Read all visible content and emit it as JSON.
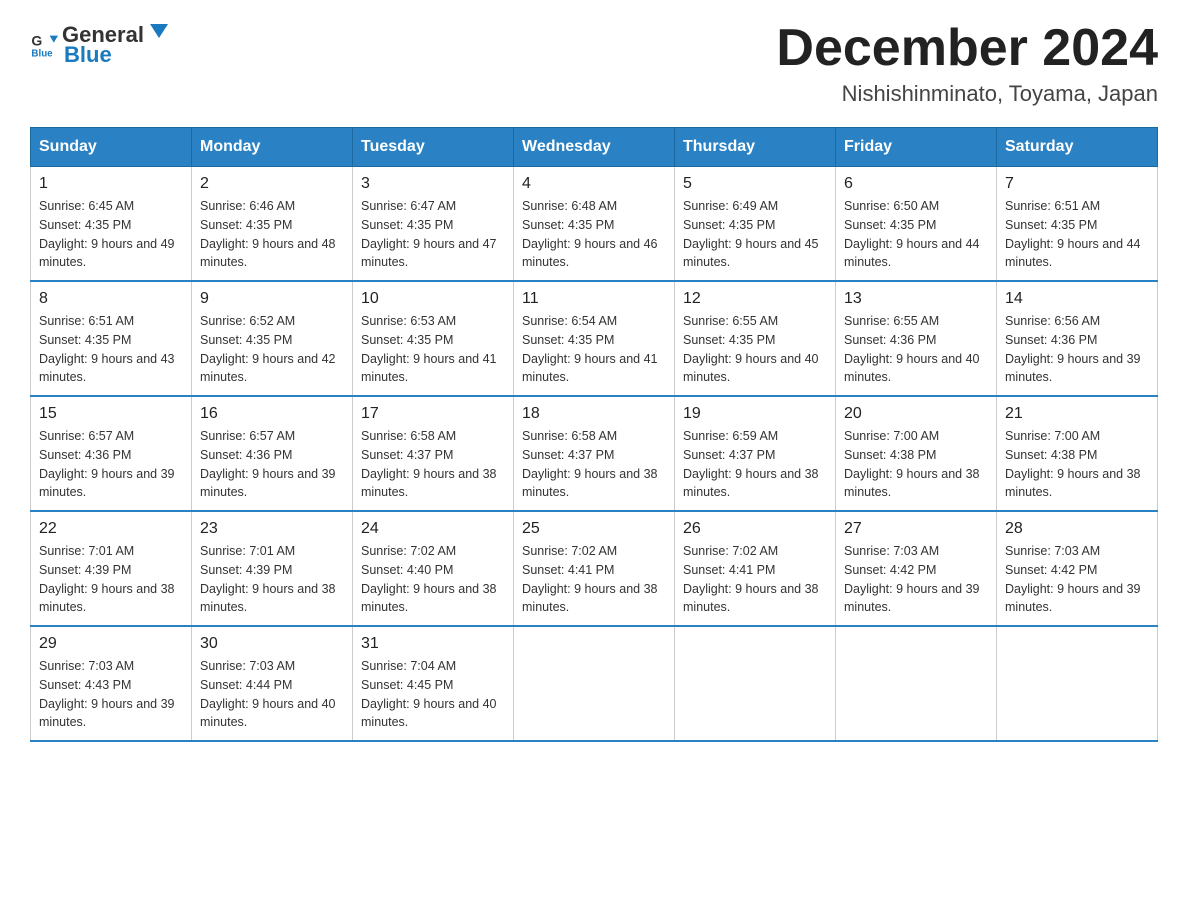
{
  "header": {
    "logo_general": "General",
    "logo_blue": "Blue",
    "month_title": "December 2024",
    "location": "Nishishinminato, Toyama, Japan"
  },
  "weekdays": [
    "Sunday",
    "Monday",
    "Tuesday",
    "Wednesday",
    "Thursday",
    "Friday",
    "Saturday"
  ],
  "weeks": [
    [
      {
        "day": "1",
        "sunrise": "6:45 AM",
        "sunset": "4:35 PM",
        "daylight": "9 hours and 49 minutes."
      },
      {
        "day": "2",
        "sunrise": "6:46 AM",
        "sunset": "4:35 PM",
        "daylight": "9 hours and 48 minutes."
      },
      {
        "day": "3",
        "sunrise": "6:47 AM",
        "sunset": "4:35 PM",
        "daylight": "9 hours and 47 minutes."
      },
      {
        "day": "4",
        "sunrise": "6:48 AM",
        "sunset": "4:35 PM",
        "daylight": "9 hours and 46 minutes."
      },
      {
        "day": "5",
        "sunrise": "6:49 AM",
        "sunset": "4:35 PM",
        "daylight": "9 hours and 45 minutes."
      },
      {
        "day": "6",
        "sunrise": "6:50 AM",
        "sunset": "4:35 PM",
        "daylight": "9 hours and 44 minutes."
      },
      {
        "day": "7",
        "sunrise": "6:51 AM",
        "sunset": "4:35 PM",
        "daylight": "9 hours and 44 minutes."
      }
    ],
    [
      {
        "day": "8",
        "sunrise": "6:51 AM",
        "sunset": "4:35 PM",
        "daylight": "9 hours and 43 minutes."
      },
      {
        "day": "9",
        "sunrise": "6:52 AM",
        "sunset": "4:35 PM",
        "daylight": "9 hours and 42 minutes."
      },
      {
        "day": "10",
        "sunrise": "6:53 AM",
        "sunset": "4:35 PM",
        "daylight": "9 hours and 41 minutes."
      },
      {
        "day": "11",
        "sunrise": "6:54 AM",
        "sunset": "4:35 PM",
        "daylight": "9 hours and 41 minutes."
      },
      {
        "day": "12",
        "sunrise": "6:55 AM",
        "sunset": "4:35 PM",
        "daylight": "9 hours and 40 minutes."
      },
      {
        "day": "13",
        "sunrise": "6:55 AM",
        "sunset": "4:36 PM",
        "daylight": "9 hours and 40 minutes."
      },
      {
        "day": "14",
        "sunrise": "6:56 AM",
        "sunset": "4:36 PM",
        "daylight": "9 hours and 39 minutes."
      }
    ],
    [
      {
        "day": "15",
        "sunrise": "6:57 AM",
        "sunset": "4:36 PM",
        "daylight": "9 hours and 39 minutes."
      },
      {
        "day": "16",
        "sunrise": "6:57 AM",
        "sunset": "4:36 PM",
        "daylight": "9 hours and 39 minutes."
      },
      {
        "day": "17",
        "sunrise": "6:58 AM",
        "sunset": "4:37 PM",
        "daylight": "9 hours and 38 minutes."
      },
      {
        "day": "18",
        "sunrise": "6:58 AM",
        "sunset": "4:37 PM",
        "daylight": "9 hours and 38 minutes."
      },
      {
        "day": "19",
        "sunrise": "6:59 AM",
        "sunset": "4:37 PM",
        "daylight": "9 hours and 38 minutes."
      },
      {
        "day": "20",
        "sunrise": "7:00 AM",
        "sunset": "4:38 PM",
        "daylight": "9 hours and 38 minutes."
      },
      {
        "day": "21",
        "sunrise": "7:00 AM",
        "sunset": "4:38 PM",
        "daylight": "9 hours and 38 minutes."
      }
    ],
    [
      {
        "day": "22",
        "sunrise": "7:01 AM",
        "sunset": "4:39 PM",
        "daylight": "9 hours and 38 minutes."
      },
      {
        "day": "23",
        "sunrise": "7:01 AM",
        "sunset": "4:39 PM",
        "daylight": "9 hours and 38 minutes."
      },
      {
        "day": "24",
        "sunrise": "7:02 AM",
        "sunset": "4:40 PM",
        "daylight": "9 hours and 38 minutes."
      },
      {
        "day": "25",
        "sunrise": "7:02 AM",
        "sunset": "4:41 PM",
        "daylight": "9 hours and 38 minutes."
      },
      {
        "day": "26",
        "sunrise": "7:02 AM",
        "sunset": "4:41 PM",
        "daylight": "9 hours and 38 minutes."
      },
      {
        "day": "27",
        "sunrise": "7:03 AM",
        "sunset": "4:42 PM",
        "daylight": "9 hours and 39 minutes."
      },
      {
        "day": "28",
        "sunrise": "7:03 AM",
        "sunset": "4:42 PM",
        "daylight": "9 hours and 39 minutes."
      }
    ],
    [
      {
        "day": "29",
        "sunrise": "7:03 AM",
        "sunset": "4:43 PM",
        "daylight": "9 hours and 39 minutes."
      },
      {
        "day": "30",
        "sunrise": "7:03 AM",
        "sunset": "4:44 PM",
        "daylight": "9 hours and 40 minutes."
      },
      {
        "day": "31",
        "sunrise": "7:04 AM",
        "sunset": "4:45 PM",
        "daylight": "9 hours and 40 minutes."
      },
      null,
      null,
      null,
      null
    ]
  ]
}
